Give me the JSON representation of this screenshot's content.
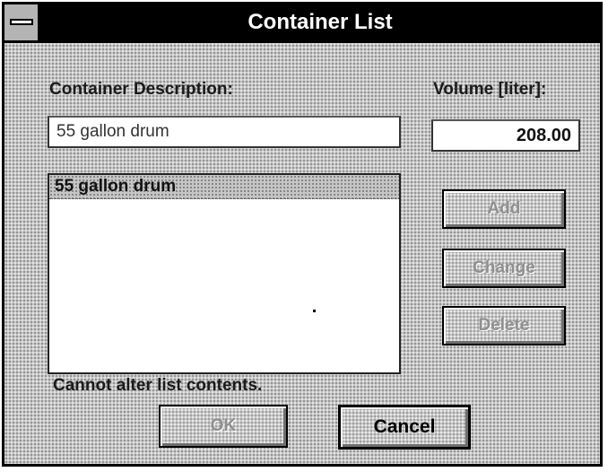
{
  "window": {
    "title": "Container List"
  },
  "labels": {
    "description": "Container Description:",
    "volume": "Volume [liter]:"
  },
  "fields": {
    "description_value": "55 gallon drum",
    "volume_value": "208.00"
  },
  "list": {
    "items": [
      "55 gallon drum"
    ]
  },
  "buttons": {
    "add": "Add",
    "change": "Change",
    "delete": "Delete",
    "ok": "OK",
    "cancel": "Cancel"
  },
  "status": {
    "message": "Cannot alter list contents."
  }
}
